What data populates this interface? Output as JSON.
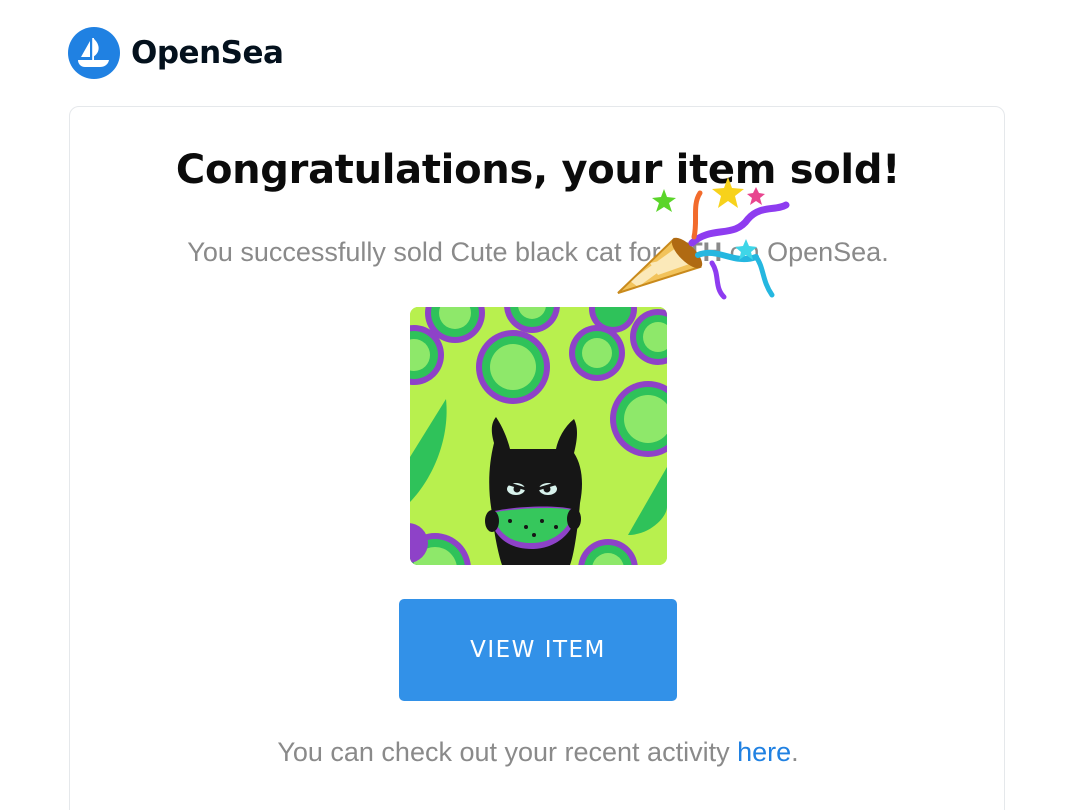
{
  "brand": {
    "name": "OpenSea",
    "logo_icon": "opensea-boat-icon",
    "accent_color": "#2081e2"
  },
  "email": {
    "title": "Congratulations, your item sold!",
    "sold_prefix": "You successfully sold ",
    "item_name": "Cute black cat",
    "for_text": " for ",
    "price": "ETH",
    "sold_suffix": " on OpenSea.",
    "decoration_icon": "party-popper-icon",
    "item_image": "cat-eating-watermelon-artwork",
    "button_label": "VIEW ITEM",
    "button_color": "#3291e8",
    "footer_prefix": "You can check out your recent activity ",
    "footer_link": "here",
    "footer_suffix": "."
  }
}
